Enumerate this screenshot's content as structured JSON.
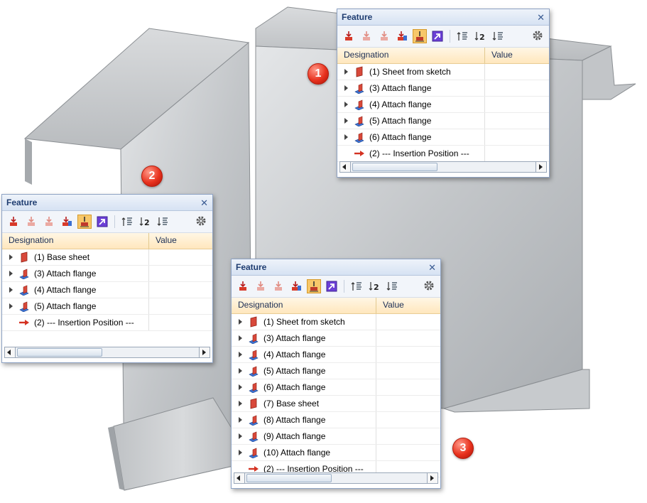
{
  "badges": [
    "1",
    "2",
    "3"
  ],
  "panels": [
    {
      "title": "Feature",
      "columns": {
        "designation": "Designation",
        "value": "Value"
      },
      "rows": [
        {
          "label": "(1) Sheet from sketch",
          "icon": "sheet-icon"
        },
        {
          "label": "(3) Attach flange",
          "icon": "flange-icon"
        },
        {
          "label": "(4) Attach flange",
          "icon": "flange-icon"
        },
        {
          "label": "(5) Attach flange",
          "icon": "flange-icon"
        },
        {
          "label": "(6) Attach flange",
          "icon": "flange-icon"
        },
        {
          "label": "(2) --- Insertion Position ---",
          "icon": "insertion-arrow-icon"
        }
      ]
    },
    {
      "title": "Feature",
      "columns": {
        "designation": "Designation",
        "value": "Value"
      },
      "rows": [
        {
          "label": "(1) Base sheet",
          "icon": "sheet-icon"
        },
        {
          "label": "(3) Attach flange",
          "icon": "flange-icon"
        },
        {
          "label": "(4) Attach flange",
          "icon": "flange-icon"
        },
        {
          "label": "(5) Attach flange",
          "icon": "flange-icon"
        },
        {
          "label": "(2) --- Insertion Position ---",
          "icon": "insertion-arrow-icon"
        }
      ]
    },
    {
      "title": "Feature",
      "columns": {
        "designation": "Designation",
        "value": "Value"
      },
      "rows": [
        {
          "label": "(1) Sheet from sketch",
          "icon": "sheet-icon"
        },
        {
          "label": "(3) Attach flange",
          "icon": "flange-icon"
        },
        {
          "label": "(4) Attach flange",
          "icon": "flange-icon"
        },
        {
          "label": "(5) Attach flange",
          "icon": "flange-icon"
        },
        {
          "label": "(6) Attach flange",
          "icon": "flange-icon"
        },
        {
          "label": "(7) Base sheet",
          "icon": "sheet-icon"
        },
        {
          "label": "(8) Attach flange",
          "icon": "flange-icon"
        },
        {
          "label": "(9) Attach flange",
          "icon": "flange-icon"
        },
        {
          "label": "(10) Attach flange",
          "icon": "flange-icon"
        },
        {
          "label": "(2) --- Insertion Position ---",
          "icon": "insertion-arrow-icon"
        }
      ]
    }
  ],
  "toolbar_icons": [
    "add-feature-icon",
    "add-feature-disabled-icon",
    "add-feature-disabled-icon",
    "edit-feature-icon",
    "insertion-mode-icon",
    "jump-icon",
    "sort-up-icon",
    "sort-number-icon",
    "sort-down-icon",
    "settings-gear-icon"
  ],
  "colors": {
    "accent_active": "#f7c76a",
    "header": "#ffe7bd",
    "title_text": "#1e3c70",
    "badge": "#e8321e",
    "sheet_metal": "#c9cbcd"
  }
}
